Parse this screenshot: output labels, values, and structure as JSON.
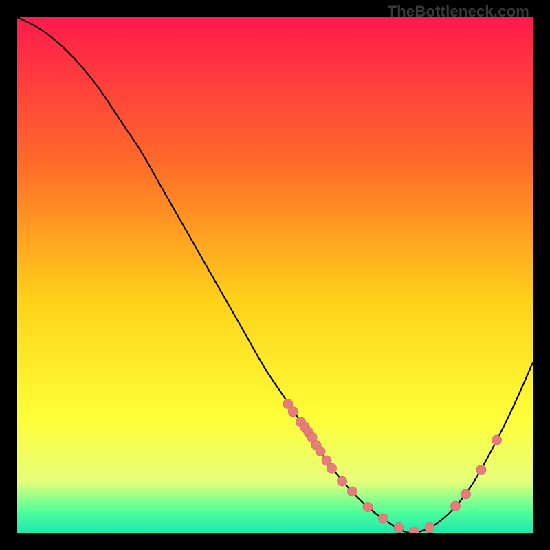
{
  "watermark": "TheBottleneck.com",
  "colors": {
    "gradient_top": "#ff1a4b",
    "gradient_mid1": "#ff6a2a",
    "gradient_mid2": "#ffd21a",
    "gradient_mid3": "#ffff3a",
    "gradient_bottom1": "#e6ff7a",
    "gradient_bottom2": "#4dff9a",
    "gradient_bottom3": "#20e6b0",
    "curve": "#000000",
    "marker_fill": "#e77c7c",
    "marker_stroke": "#d66a6a"
  },
  "chart_data": {
    "type": "line",
    "title": "",
    "xlabel": "",
    "ylabel": "",
    "xlim": [
      0,
      100
    ],
    "ylim": [
      0,
      100
    ],
    "series": [
      {
        "name": "bottleneck-curve",
        "x": [
          0,
          4,
          8,
          12,
          16,
          20,
          24,
          28,
          32,
          36,
          40,
          44,
          48,
          52,
          56,
          60,
          64,
          68,
          72,
          76,
          80,
          84,
          88,
          92,
          96,
          100
        ],
        "y": [
          100,
          98,
          95,
          91,
          86,
          80,
          74,
          67,
          60,
          53,
          46,
          39,
          32,
          26,
          20,
          14,
          9,
          5,
          2,
          0,
          1,
          4,
          9,
          16,
          24,
          33
        ]
      }
    ],
    "markers": {
      "name": "highlighted-points",
      "x": [
        52.5,
        53.5,
        55.0,
        55.8,
        56.5,
        57.2,
        58.0,
        58.8,
        60.0,
        61.0,
        63.0,
        65.0,
        68.0,
        71.0,
        74.0,
        77.0,
        80.0,
        85.0,
        87.0,
        90.0,
        93.0
      ],
      "y": [
        25.0,
        23.5,
        21.5,
        20.5,
        19.5,
        18.5,
        17.0,
        15.8,
        14.0,
        12.5,
        10.0,
        8.0,
        5.0,
        2.8,
        1.0,
        0.2,
        1.0,
        5.2,
        7.5,
        12.2,
        18.0
      ]
    },
    "marker_radius": 7
  }
}
